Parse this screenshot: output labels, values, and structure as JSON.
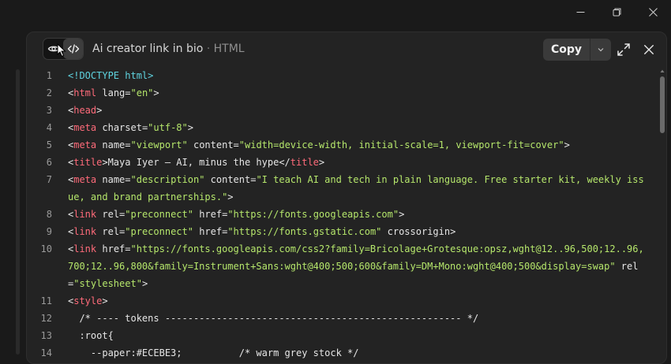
{
  "window": {
    "controls": [
      "minimize-icon",
      "restore-icon",
      "close-icon"
    ]
  },
  "header": {
    "title": "Ai creator link in bio",
    "separator": " · ",
    "file_type": "HTML",
    "copy_label": "Copy",
    "icons": [
      "eye-icon",
      "code-icon",
      "chevron-down-icon",
      "expand-icon",
      "close-icon"
    ]
  },
  "colors": {
    "background": "#1a1a1a",
    "panel": "#232323",
    "doctype": "#5fd3df",
    "tag": "#ff6b7a",
    "string": "#b5e66b",
    "text": "#e6e6e6"
  },
  "code_lines": [
    {
      "n": "1",
      "tokens": [
        {
          "t": "<!DOCTYPE html>",
          "c": "doc"
        }
      ]
    },
    {
      "n": "2",
      "tokens": [
        {
          "t": "<",
          "c": "plain"
        },
        {
          "t": "html",
          "c": "tag"
        },
        {
          "t": " lang=",
          "c": "attr"
        },
        {
          "t": "\"en\"",
          "c": "str"
        },
        {
          "t": ">",
          "c": "plain"
        }
      ]
    },
    {
      "n": "3",
      "tokens": [
        {
          "t": "<",
          "c": "plain"
        },
        {
          "t": "head",
          "c": "tag"
        },
        {
          "t": ">",
          "c": "plain"
        }
      ]
    },
    {
      "n": "4",
      "tokens": [
        {
          "t": "<",
          "c": "plain"
        },
        {
          "t": "meta",
          "c": "tag"
        },
        {
          "t": " charset=",
          "c": "attr"
        },
        {
          "t": "\"utf-8\"",
          "c": "str"
        },
        {
          "t": ">",
          "c": "plain"
        }
      ]
    },
    {
      "n": "5",
      "tokens": [
        {
          "t": "<",
          "c": "plain"
        },
        {
          "t": "meta",
          "c": "tag"
        },
        {
          "t": " name=",
          "c": "attr"
        },
        {
          "t": "\"viewport\"",
          "c": "str"
        },
        {
          "t": " content=",
          "c": "attr"
        },
        {
          "t": "\"width=device-width, initial-scale=1, viewport-fit=cover\"",
          "c": "str"
        },
        {
          "t": ">",
          "c": "plain"
        }
      ]
    },
    {
      "n": "6",
      "tokens": [
        {
          "t": "<",
          "c": "plain"
        },
        {
          "t": "title",
          "c": "tag"
        },
        {
          "t": ">Maya Iyer — AI, minus the hype</",
          "c": "plain"
        },
        {
          "t": "title",
          "c": "tag"
        },
        {
          "t": ">",
          "c": "plain"
        }
      ]
    },
    {
      "n": "7",
      "tokens": [
        {
          "t": "<",
          "c": "plain"
        },
        {
          "t": "meta",
          "c": "tag"
        },
        {
          "t": " name=",
          "c": "attr"
        },
        {
          "t": "\"description\"",
          "c": "str"
        },
        {
          "t": " content=",
          "c": "attr"
        },
        {
          "t": "\"I teach AI and tech in plain language. Free starter kit, weekly issue, and brand partnerships.\"",
          "c": "str"
        },
        {
          "t": ">",
          "c": "plain"
        }
      ]
    },
    {
      "n": "8",
      "tokens": [
        {
          "t": "<",
          "c": "plain"
        },
        {
          "t": "link",
          "c": "tag"
        },
        {
          "t": " rel=",
          "c": "attr"
        },
        {
          "t": "\"preconnect\"",
          "c": "str"
        },
        {
          "t": " href=",
          "c": "attr"
        },
        {
          "t": "\"https://fonts.googleapis.com\"",
          "c": "str"
        },
        {
          "t": ">",
          "c": "plain"
        }
      ]
    },
    {
      "n": "9",
      "tokens": [
        {
          "t": "<",
          "c": "plain"
        },
        {
          "t": "link",
          "c": "tag"
        },
        {
          "t": " rel=",
          "c": "attr"
        },
        {
          "t": "\"preconnect\"",
          "c": "str"
        },
        {
          "t": " href=",
          "c": "attr"
        },
        {
          "t": "\"https://fonts.gstatic.com\"",
          "c": "str"
        },
        {
          "t": " crossorigin>",
          "c": "attr"
        }
      ]
    },
    {
      "n": "10",
      "tokens": [
        {
          "t": "<",
          "c": "plain"
        },
        {
          "t": "link",
          "c": "tag"
        },
        {
          "t": " href=",
          "c": "attr"
        },
        {
          "t": "\"https://fonts.googleapis.com/css2?family=Bricolage+Grotesque:opsz,wght@12..96,500;12..96,700;12..96,800&family=Instrument+Sans:wght@400;500;600&family=DM+Mono:wght@400;500&display=swap\"",
          "c": "str"
        },
        {
          "t": " rel=",
          "c": "attr"
        },
        {
          "t": "\"stylesheet\"",
          "c": "str"
        },
        {
          "t": ">",
          "c": "plain"
        }
      ]
    },
    {
      "n": "11",
      "tokens": [
        {
          "t": "<",
          "c": "plain"
        },
        {
          "t": "style",
          "c": "tag"
        },
        {
          "t": ">",
          "c": "plain"
        }
      ]
    },
    {
      "n": "12",
      "tokens": [
        {
          "t": "  /* ---- tokens ---------------------------------------------------- */",
          "c": "com"
        }
      ]
    },
    {
      "n": "13",
      "tokens": [
        {
          "t": "  :root{",
          "c": "plain"
        }
      ]
    },
    {
      "n": "14",
      "tokens": [
        {
          "t": "    --paper:#ECEBE3;          /* warm grey stock */",
          "c": "plain"
        }
      ]
    }
  ]
}
